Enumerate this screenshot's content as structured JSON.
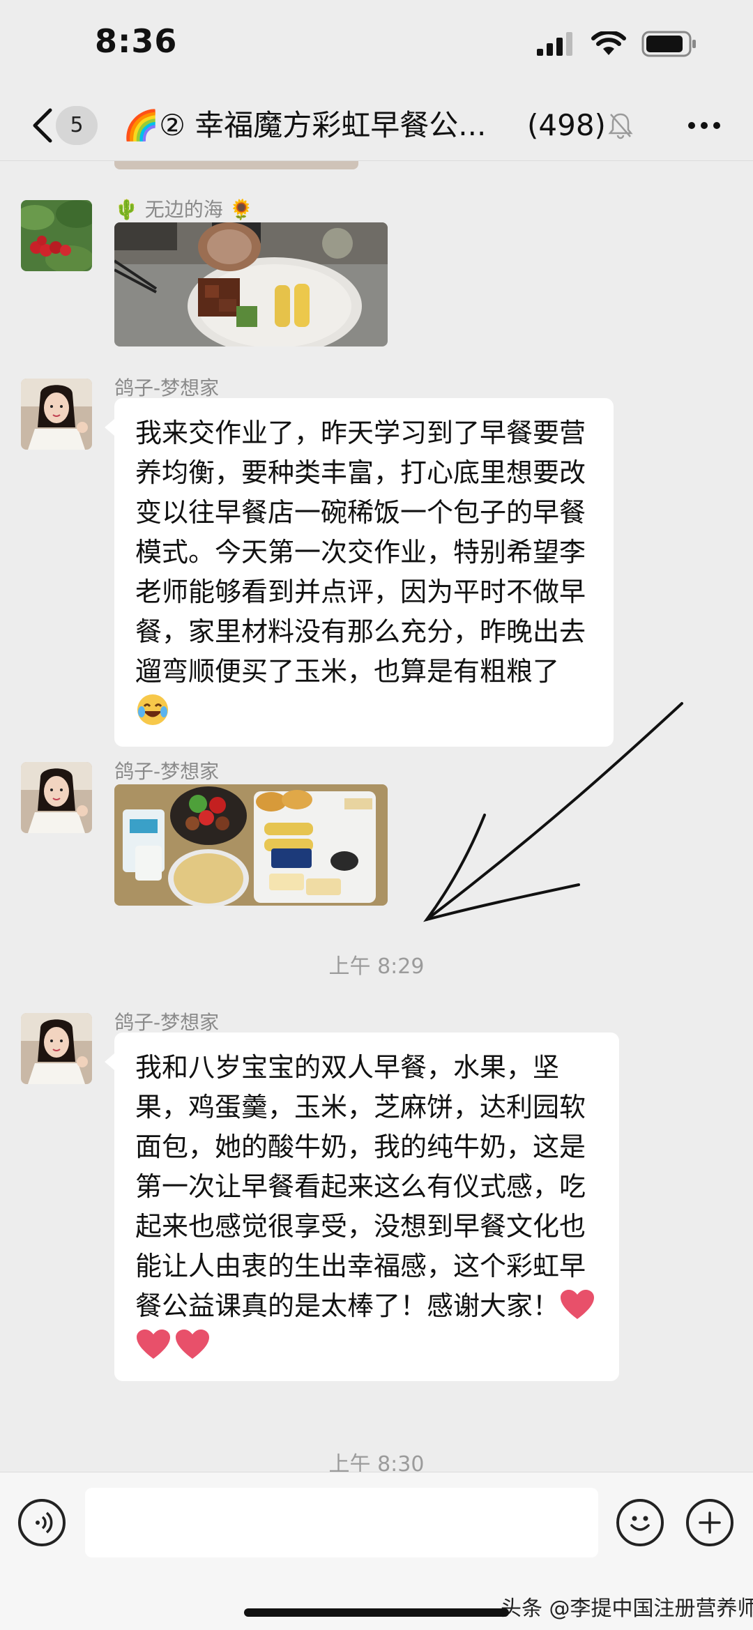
{
  "status_bar": {
    "time": "8:36"
  },
  "nav": {
    "unread_count": "5",
    "title": "🌈② 幸福魔方彩虹早餐公...",
    "member_count": "(498)"
  },
  "messages": [
    {
      "sender": "🌵 无边的海 🌻",
      "type": "image",
      "image_desc": "breakfast-plate-1"
    },
    {
      "sender": "鸽子-梦想家",
      "type": "text",
      "text": "我来交作业了，昨天学习到了早餐要营养均衡，要种类丰富，打心底里想要改变以往早餐店一碗稀饭一个包子的早餐模式。今天第一次交作业，特别希望李老师能够看到并点评，因为平时不做早餐，家里材料没有那么充分，昨晚出去遛弯顺便买了玉米，也算是有粗粮了"
    },
    {
      "sender": "鸽子-梦想家",
      "type": "image",
      "image_desc": "breakfast-table-2"
    },
    {
      "time": "上午 8:29"
    },
    {
      "sender": "鸽子-梦想家",
      "type": "text",
      "text": "我和八岁宝宝的双人早餐，水果，坚果，鸡蛋羹，玉米，芝麻饼，达利园软面包，她的酸牛奶，我的纯牛奶，这是第一次让早餐看起来这么有仪式感，吃起来也感觉很享受，没想到早餐文化也能让人由衷的生出幸福感，这个彩虹早餐公益课真的是太棒了！感谢大家！"
    },
    {
      "time": "上午 8:30"
    }
  ],
  "input": {
    "placeholder": ""
  },
  "watermark": "头条 @李提中国注册营养师",
  "colors": {
    "background": "#ededed",
    "bubble": "#ffffff",
    "heart": "#e8506a"
  }
}
